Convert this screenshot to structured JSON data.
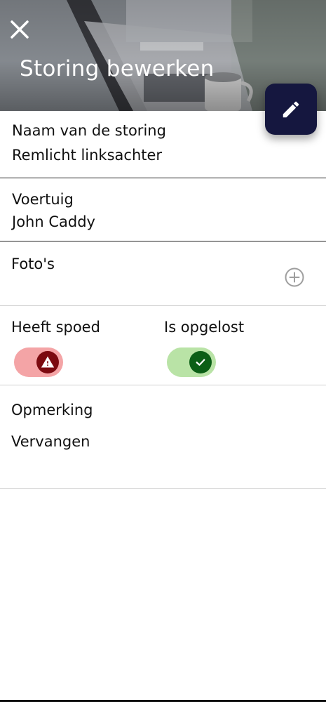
{
  "header": {
    "title": "Storing bewerken",
    "background_image": "laptop-desk-photo",
    "close_icon": "close-icon",
    "edit_icon": "pencil-icon",
    "fab_color": "#15173f"
  },
  "fields": {
    "name": {
      "label": "Naam van de storing",
      "value": "Remlicht linksachter"
    },
    "vehicle": {
      "label": "Voertuig",
      "value": "John Caddy"
    },
    "photos": {
      "label": "Foto's",
      "add_icon": "add-circle-icon"
    },
    "urgent": {
      "label": "Heeft spoed",
      "state": "on",
      "icon": "warning-icon",
      "track_color": "#f4a4a6",
      "knob_color": "#7c0a10"
    },
    "resolved": {
      "label": "Is opgelost",
      "state": "on",
      "icon": "check-icon",
      "track_color": "#b9e3a6",
      "knob_color": "#0b5f16"
    },
    "remark": {
      "label": "Opmerking",
      "value": "Vervangen"
    }
  }
}
